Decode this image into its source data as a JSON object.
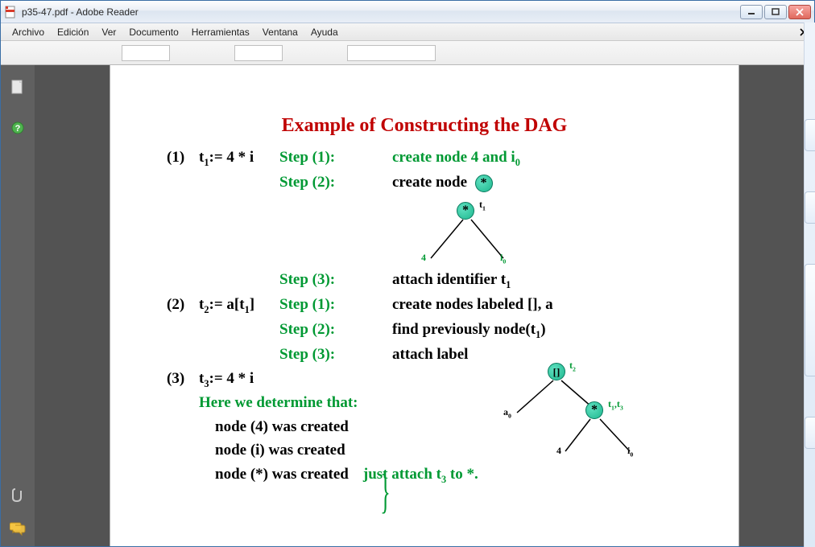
{
  "window": {
    "title": "p35-47.pdf - Adobe Reader"
  },
  "menu": {
    "archivo": "Archivo",
    "edicion": "Edición",
    "ver": "Ver",
    "documento": "Documento",
    "herramientas": "Herramientas",
    "ventana": "Ventana",
    "ayuda": "Ayuda"
  },
  "doc": {
    "title": "Example of Constructing the DAG",
    "r1_num": "(1)",
    "r1_code": "t",
    "r1_code_sub": "1",
    "r1_code_rest": ":= 4 * i",
    "step1": "Step (1):",
    "step2": "Step (2):",
    "step3": "Step (3):",
    "r1_desc1a": "create node 4 and i",
    "r1_desc1a_sub": "0",
    "r1_desc2": "create node",
    "tree1_top": "t",
    "tree1_top_sub": "1",
    "tree1_left": "4",
    "tree1_right": "i",
    "tree1_right_sub": "0",
    "r1_desc3a": "attach identifier t",
    "r1_desc3a_sub": "1",
    "r2_num": "(2)",
    "r2_code_pre": "t",
    "r2_code_sub": "2",
    "r2_code_mid": ":= a[t",
    "r2_code_sub2": "1",
    "r2_code_end": "]",
    "r2_desc1": "create nodes labeled [], a",
    "r2_desc2a": "find previously node(t",
    "r2_desc2a_sub": "1",
    "r2_desc2b": ")",
    "r2_desc3": "attach label",
    "r3_num": "(3)",
    "r3_code_pre": "t",
    "r3_code_sub": "3",
    "r3_code_rest": ":= 4 * i",
    "here": "Here we determine that:",
    "note1": "node (4) was created",
    "note2": "node (i) was created",
    "note3": "node (*) was created",
    "attach_pre": "just attach t",
    "attach_sub": "3",
    "attach_post": " to *.",
    "tree2_top_lab": "t",
    "tree2_top_lab_sub": "2",
    "tree2_top_node": "[]",
    "tree2_a": "a",
    "tree2_a_sub": "0",
    "tree2_star_lab_pre": "t",
    "tree2_star_lab_sub1": "1",
    "tree2_star_lab_mid": ",t",
    "tree2_star_lab_sub2": "3",
    "tree2_4": "4",
    "tree2_i": "i",
    "tree2_i_sub": "0",
    "star": "*"
  }
}
